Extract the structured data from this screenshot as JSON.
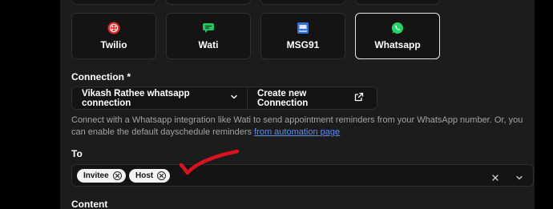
{
  "providers": [
    {
      "label": "Twilio",
      "icon": "twilio-icon",
      "selected": false
    },
    {
      "label": "Wati",
      "icon": "wati-chat-icon",
      "selected": false
    },
    {
      "label": "MSG91",
      "icon": "msg91-icon",
      "selected": false
    },
    {
      "label": "Whatsapp",
      "icon": "whatsapp-icon",
      "selected": true
    }
  ],
  "connection": {
    "label": "Connection *",
    "selected_value": "Vikash Rathee whatsapp connection",
    "create_label": "Create new Connection"
  },
  "description": {
    "text": "Connect with a Whatsapp integration like Wati to send appointment reminders from your WhatsApp number. Or, you can enable the default dayschedule reminders",
    "link_text": "from automation page"
  },
  "to": {
    "label": "To",
    "chips": [
      "Invitee",
      "Host"
    ]
  },
  "content": {
    "label": "Content"
  },
  "colors": {
    "twilio": "#e0282e",
    "wati": "#22c55e",
    "msg91": "#2f6fd6",
    "whatsapp": "#25d366",
    "annotation": "#d8121f",
    "link": "#5b8def"
  }
}
